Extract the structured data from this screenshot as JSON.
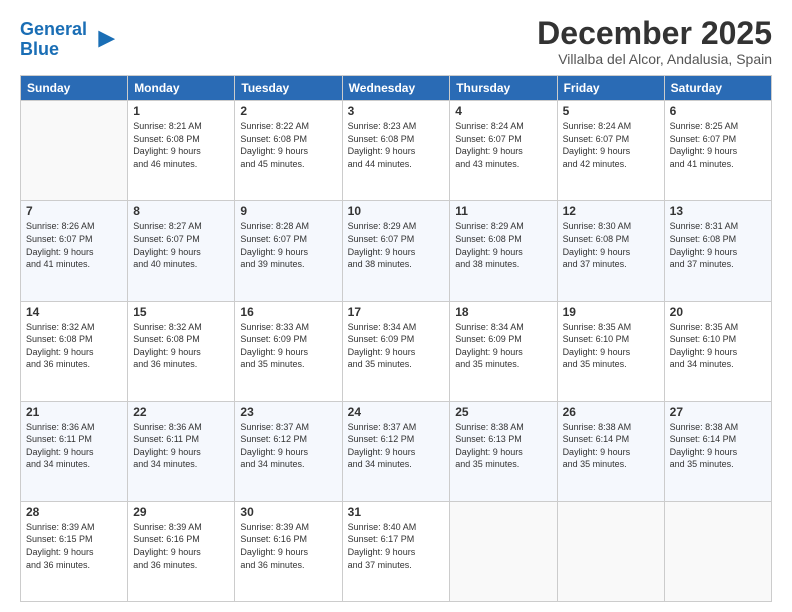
{
  "header": {
    "logo": {
      "line1": "General",
      "line2": "Blue"
    },
    "title": "December 2025",
    "location": "Villalba del Alcor, Andalusia, Spain"
  },
  "days_of_week": [
    "Sunday",
    "Monday",
    "Tuesday",
    "Wednesday",
    "Thursday",
    "Friday",
    "Saturday"
  ],
  "weeks": [
    [
      {
        "day": "",
        "info": ""
      },
      {
        "day": "1",
        "info": "Sunrise: 8:21 AM\nSunset: 6:08 PM\nDaylight: 9 hours\nand 46 minutes."
      },
      {
        "day": "2",
        "info": "Sunrise: 8:22 AM\nSunset: 6:08 PM\nDaylight: 9 hours\nand 45 minutes."
      },
      {
        "day": "3",
        "info": "Sunrise: 8:23 AM\nSunset: 6:08 PM\nDaylight: 9 hours\nand 44 minutes."
      },
      {
        "day": "4",
        "info": "Sunrise: 8:24 AM\nSunset: 6:07 PM\nDaylight: 9 hours\nand 43 minutes."
      },
      {
        "day": "5",
        "info": "Sunrise: 8:24 AM\nSunset: 6:07 PM\nDaylight: 9 hours\nand 42 minutes."
      },
      {
        "day": "6",
        "info": "Sunrise: 8:25 AM\nSunset: 6:07 PM\nDaylight: 9 hours\nand 41 minutes."
      }
    ],
    [
      {
        "day": "7",
        "info": "Sunrise: 8:26 AM\nSunset: 6:07 PM\nDaylight: 9 hours\nand 41 minutes."
      },
      {
        "day": "8",
        "info": "Sunrise: 8:27 AM\nSunset: 6:07 PM\nDaylight: 9 hours\nand 40 minutes."
      },
      {
        "day": "9",
        "info": "Sunrise: 8:28 AM\nSunset: 6:07 PM\nDaylight: 9 hours\nand 39 minutes."
      },
      {
        "day": "10",
        "info": "Sunrise: 8:29 AM\nSunset: 6:07 PM\nDaylight: 9 hours\nand 38 minutes."
      },
      {
        "day": "11",
        "info": "Sunrise: 8:29 AM\nSunset: 6:08 PM\nDaylight: 9 hours\nand 38 minutes."
      },
      {
        "day": "12",
        "info": "Sunrise: 8:30 AM\nSunset: 6:08 PM\nDaylight: 9 hours\nand 37 minutes."
      },
      {
        "day": "13",
        "info": "Sunrise: 8:31 AM\nSunset: 6:08 PM\nDaylight: 9 hours\nand 37 minutes."
      }
    ],
    [
      {
        "day": "14",
        "info": "Sunrise: 8:32 AM\nSunset: 6:08 PM\nDaylight: 9 hours\nand 36 minutes."
      },
      {
        "day": "15",
        "info": "Sunrise: 8:32 AM\nSunset: 6:08 PM\nDaylight: 9 hours\nand 36 minutes."
      },
      {
        "day": "16",
        "info": "Sunrise: 8:33 AM\nSunset: 6:09 PM\nDaylight: 9 hours\nand 35 minutes."
      },
      {
        "day": "17",
        "info": "Sunrise: 8:34 AM\nSunset: 6:09 PM\nDaylight: 9 hours\nand 35 minutes."
      },
      {
        "day": "18",
        "info": "Sunrise: 8:34 AM\nSunset: 6:09 PM\nDaylight: 9 hours\nand 35 minutes."
      },
      {
        "day": "19",
        "info": "Sunrise: 8:35 AM\nSunset: 6:10 PM\nDaylight: 9 hours\nand 35 minutes."
      },
      {
        "day": "20",
        "info": "Sunrise: 8:35 AM\nSunset: 6:10 PM\nDaylight: 9 hours\nand 34 minutes."
      }
    ],
    [
      {
        "day": "21",
        "info": "Sunrise: 8:36 AM\nSunset: 6:11 PM\nDaylight: 9 hours\nand 34 minutes."
      },
      {
        "day": "22",
        "info": "Sunrise: 8:36 AM\nSunset: 6:11 PM\nDaylight: 9 hours\nand 34 minutes."
      },
      {
        "day": "23",
        "info": "Sunrise: 8:37 AM\nSunset: 6:12 PM\nDaylight: 9 hours\nand 34 minutes."
      },
      {
        "day": "24",
        "info": "Sunrise: 8:37 AM\nSunset: 6:12 PM\nDaylight: 9 hours\nand 34 minutes."
      },
      {
        "day": "25",
        "info": "Sunrise: 8:38 AM\nSunset: 6:13 PM\nDaylight: 9 hours\nand 35 minutes."
      },
      {
        "day": "26",
        "info": "Sunrise: 8:38 AM\nSunset: 6:14 PM\nDaylight: 9 hours\nand 35 minutes."
      },
      {
        "day": "27",
        "info": "Sunrise: 8:38 AM\nSunset: 6:14 PM\nDaylight: 9 hours\nand 35 minutes."
      }
    ],
    [
      {
        "day": "28",
        "info": "Sunrise: 8:39 AM\nSunset: 6:15 PM\nDaylight: 9 hours\nand 36 minutes."
      },
      {
        "day": "29",
        "info": "Sunrise: 8:39 AM\nSunset: 6:16 PM\nDaylight: 9 hours\nand 36 minutes."
      },
      {
        "day": "30",
        "info": "Sunrise: 8:39 AM\nSunset: 6:16 PM\nDaylight: 9 hours\nand 36 minutes."
      },
      {
        "day": "31",
        "info": "Sunrise: 8:40 AM\nSunset: 6:17 PM\nDaylight: 9 hours\nand 37 minutes."
      },
      {
        "day": "",
        "info": ""
      },
      {
        "day": "",
        "info": ""
      },
      {
        "day": "",
        "info": ""
      }
    ]
  ]
}
